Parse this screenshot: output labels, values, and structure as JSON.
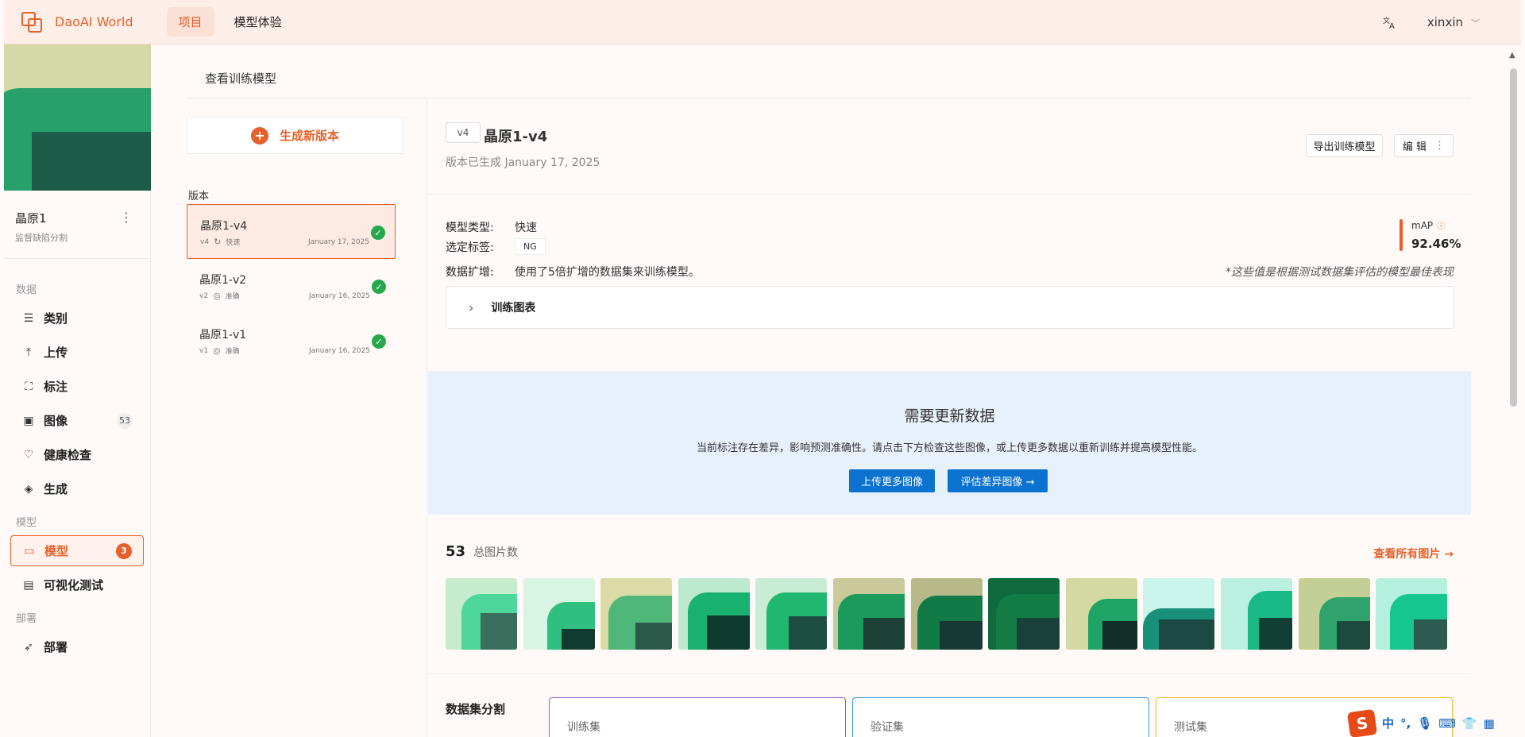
{
  "app": {
    "name": "DaoAI World"
  },
  "nav": {
    "items": [
      {
        "label": "项目",
        "active": true
      },
      {
        "label": "模型体验",
        "active": false
      }
    ]
  },
  "user": {
    "name": "xinxin"
  },
  "project": {
    "name": "晶原1",
    "type": "监督缺陷分割"
  },
  "sidebar": {
    "sections": {
      "data": "数据",
      "model": "模型",
      "deploy": "部署"
    },
    "items": [
      {
        "label": "类别",
        "icon": "list-icon"
      },
      {
        "label": "上传",
        "icon": "upload-icon"
      },
      {
        "label": "标注",
        "icon": "annotate-icon"
      },
      {
        "label": "图像",
        "icon": "image-icon",
        "badge": "53"
      },
      {
        "label": "健康检查",
        "icon": "heart-icon"
      },
      {
        "label": "生成",
        "icon": "layers-icon"
      },
      {
        "label": "模型",
        "icon": "folder-icon",
        "badge": "3",
        "active": true
      },
      {
        "label": "可视化测试",
        "icon": "document-icon"
      },
      {
        "label": "部署",
        "icon": "rocket-icon"
      }
    ]
  },
  "page": {
    "title": "查看训练模型"
  },
  "versions": {
    "generate_label": "生成新版本",
    "section_label": "版本",
    "items": [
      {
        "name": "晶原1-v4",
        "tag": "v4",
        "mode": "快速",
        "date": "January 17, 2025",
        "active": true
      },
      {
        "name": "晶原1-v2",
        "tag": "v2",
        "mode": "准确",
        "date": "January 16, 2025",
        "active": false
      },
      {
        "name": "晶原1-v1",
        "tag": "v1",
        "mode": "准确",
        "date": "January 16, 2025",
        "active": false
      }
    ]
  },
  "detail": {
    "tag": "v4",
    "title": "晶原1-v4",
    "subtitle": "版本已生成 January 17, 2025",
    "export_label": "导出训练模型",
    "edit_label": "编 辑",
    "model_type_key": "模型类型:",
    "model_type_val": "快速",
    "label_key": "选定标签:",
    "label_val": "NG",
    "aug_key": "数据扩增:",
    "aug_val": "使用了5倍扩增的数据集来训练模型。",
    "map_label": "mAP",
    "map_value": "92.46%",
    "note": "*这些值是根据测试数据集评估的模型最佳表现",
    "chart_toggle": "训练图表"
  },
  "alert": {
    "title": "需要更新数据",
    "text": "当前标注存在差异，影响预测准确性。请点击下方检查这些图像，或上传更多数据以重新训练并提高模型性能。",
    "upload_label": "上传更多图像",
    "evaluate_label": "评估差异图像 →"
  },
  "images": {
    "count": "53",
    "count_label": "总图片数",
    "view_all": "查看所有图片 →",
    "thumbs": [
      {
        "bg": "#c7eccd",
        "c": "#4fd69a",
        "d": "#3a6e5d"
      },
      {
        "bg": "#d7f5e2",
        "c": "#2fc07f",
        "d": "#123b30"
      },
      {
        "bg": "#dcdba7",
        "c": "#4fb878",
        "d": "#2a5a4a"
      },
      {
        "bg": "#bde9cf",
        "c": "#18b16f",
        "d": "#0f3a2e"
      },
      {
        "bg": "#c9ecd5",
        "c": "#20b86f",
        "d": "#1d4e42"
      },
      {
        "bg": "#c9c99a",
        "c": "#1c9a5b",
        "d": "#1c3f36"
      },
      {
        "bg": "#b8b989",
        "c": "#127a46",
        "d": "#163a33"
      },
      {
        "bg": "#0f6a3e",
        "c": "#137c46",
        "d": "#1a4139"
      },
      {
        "bg": "#d4d9a3",
        "c": "#20a466",
        "d": "#112e28"
      },
      {
        "bg": "#c9f5ec",
        "c": "#19907a",
        "d": "#1b4a45"
      },
      {
        "bg": "#b9f0e0",
        "c": "#19b986",
        "d": "#123f34"
      },
      {
        "bg": "#c4cf95",
        "c": "#2fa36b",
        "d": "#1c4a3d"
      },
      {
        "bg": "#b5f0de",
        "c": "#16c790",
        "d": "#2d5b52"
      }
    ]
  },
  "split": {
    "label": "数据集分割",
    "train": "训练集",
    "val": "验证集",
    "test": "测试集",
    "colors": {
      "train": "#9b59d0",
      "val": "#3498db",
      "test": "#f0b429"
    }
  },
  "ime": {
    "lang": "中"
  }
}
